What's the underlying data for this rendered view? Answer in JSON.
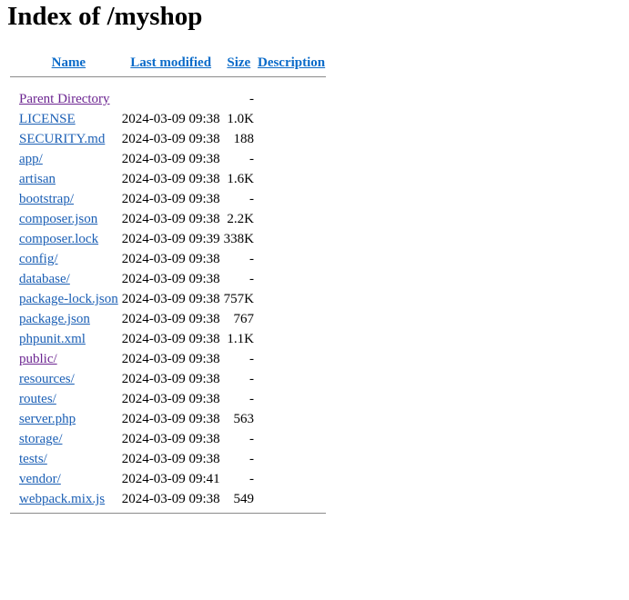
{
  "page_title": "Index of /myshop",
  "columns": {
    "name": "Name",
    "last_modified": "Last modified",
    "size": "Size",
    "description": "Description"
  },
  "parent": {
    "name": "Parent Directory",
    "modified": "",
    "size": "-"
  },
  "entries": [
    {
      "name": "LICENSE",
      "modified": "2024-03-09 09:38",
      "size": "1.0K"
    },
    {
      "name": "SECURITY.md",
      "modified": "2024-03-09 09:38",
      "size": "188"
    },
    {
      "name": "app/",
      "modified": "2024-03-09 09:38",
      "size": "-"
    },
    {
      "name": "artisan",
      "modified": "2024-03-09 09:38",
      "size": "1.6K"
    },
    {
      "name": "bootstrap/",
      "modified": "2024-03-09 09:38",
      "size": "-"
    },
    {
      "name": "composer.json",
      "modified": "2024-03-09 09:38",
      "size": "2.2K"
    },
    {
      "name": "composer.lock",
      "modified": "2024-03-09 09:39",
      "size": "338K"
    },
    {
      "name": "config/",
      "modified": "2024-03-09 09:38",
      "size": "-"
    },
    {
      "name": "database/",
      "modified": "2024-03-09 09:38",
      "size": "-"
    },
    {
      "name": "package-lock.json",
      "modified": "2024-03-09 09:38",
      "size": "757K"
    },
    {
      "name": "package.json",
      "modified": "2024-03-09 09:38",
      "size": "767"
    },
    {
      "name": "phpunit.xml",
      "modified": "2024-03-09 09:38",
      "size": "1.1K"
    },
    {
      "name": "public/",
      "modified": "2024-03-09 09:38",
      "size": "-",
      "visited": true
    },
    {
      "name": "resources/",
      "modified": "2024-03-09 09:38",
      "size": "-"
    },
    {
      "name": "routes/",
      "modified": "2024-03-09 09:38",
      "size": "-"
    },
    {
      "name": "server.php",
      "modified": "2024-03-09 09:38",
      "size": "563"
    },
    {
      "name": "storage/",
      "modified": "2024-03-09 09:38",
      "size": "-"
    },
    {
      "name": "tests/",
      "modified": "2024-03-09 09:38",
      "size": "-"
    },
    {
      "name": "vendor/",
      "modified": "2024-03-09 09:41",
      "size": "-"
    },
    {
      "name": "webpack.mix.js",
      "modified": "2024-03-09 09:38",
      "size": "549"
    }
  ],
  "colors": {
    "link": "#1b5fb5",
    "visited_link": "#6c2591",
    "header_link": "#0b6bc9",
    "rule": "#8a8a8a"
  }
}
